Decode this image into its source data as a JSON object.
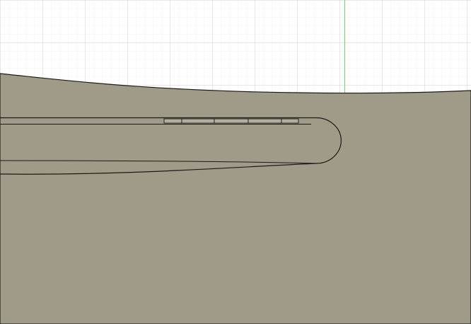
{
  "viewport": {
    "grid_visible": true,
    "grid_minor_color": "#e6e6e6",
    "grid_major_color": "#cfcfcf",
    "y_axis_color": "#6fd66f",
    "background_color": "#ffffff"
  },
  "body": {
    "fill_color": "#a09a88",
    "outline_color": "#1a1a1a"
  },
  "segments": {
    "fill_color": "#b4ae9c",
    "count": 5
  }
}
